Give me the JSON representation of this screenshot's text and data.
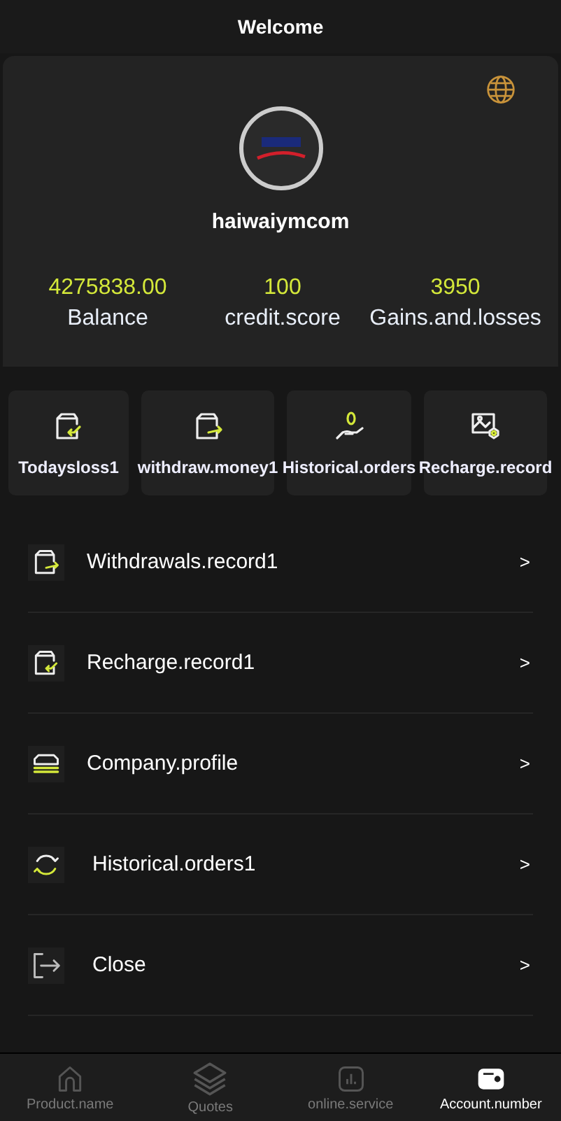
{
  "header": {
    "title": "Welcome"
  },
  "profile": {
    "username": "haiwaiymcom",
    "stats": [
      {
        "value": "4275838.00",
        "label": "Balance"
      },
      {
        "value": "100",
        "label": "credit.score"
      },
      {
        "value": "3950",
        "label": "Gains.and.losses"
      }
    ]
  },
  "quick_actions": [
    {
      "kind": "wallet-in",
      "label": "Todaysloss1"
    },
    {
      "kind": "wallet-out",
      "label": "withdraw.money1"
    },
    {
      "kind": "coin-hand",
      "label": "Historical.orders"
    },
    {
      "kind": "image-gear",
      "label": "Recharge.record"
    }
  ],
  "menu": [
    {
      "kind": "wallet-out",
      "label": "Withdrawals.record1",
      "chevron": ">"
    },
    {
      "kind": "wallet-in",
      "label": "Recharge.record1",
      "chevron": ">"
    },
    {
      "kind": "stack",
      "label": "Company.profile",
      "chevron": ">"
    },
    {
      "kind": "refresh",
      "label": "Historical.orders1",
      "chevron": ">"
    },
    {
      "kind": "logout",
      "label": "Close",
      "chevron": ">"
    }
  ],
  "tab_bar": [
    {
      "kind": "home",
      "label": "Product.name",
      "selected": false
    },
    {
      "kind": "layers",
      "label": "Quotes",
      "selected": false
    },
    {
      "kind": "chart",
      "label": "online.service",
      "selected": false
    },
    {
      "kind": "wallet",
      "label": "Account.number",
      "selected": true
    }
  ]
}
